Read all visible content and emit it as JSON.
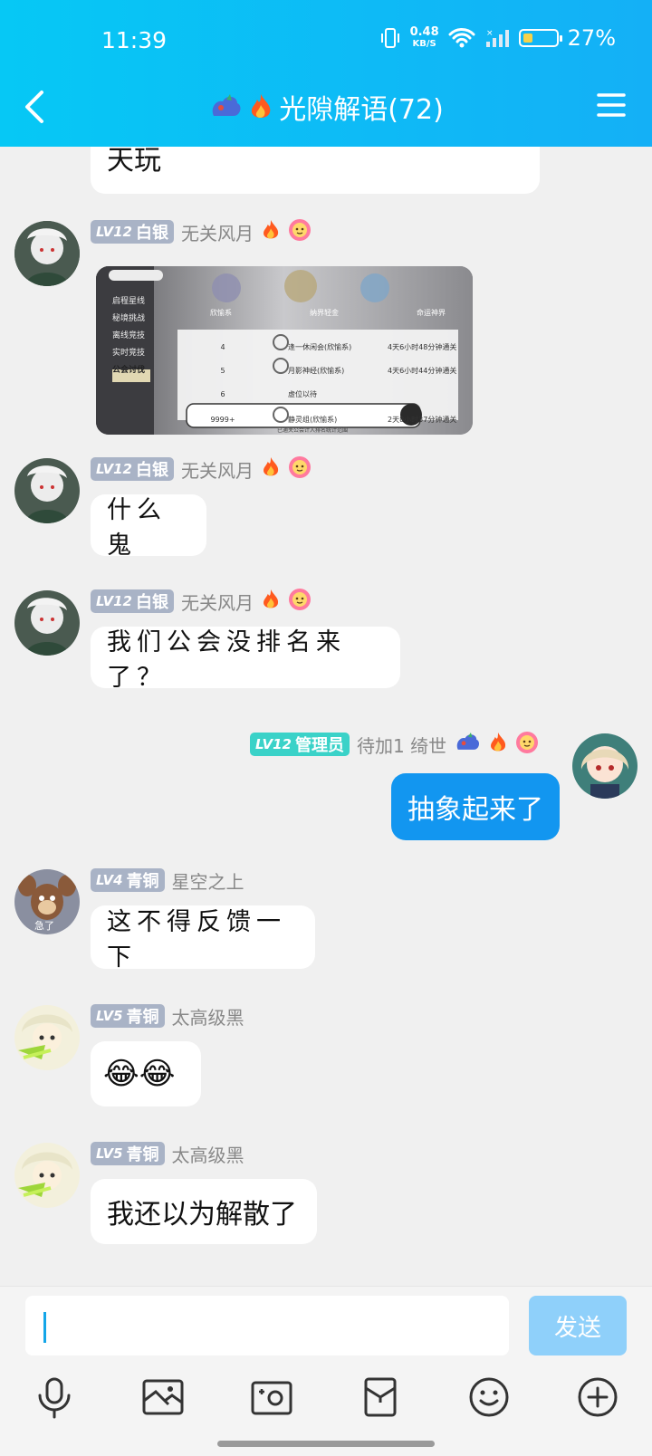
{
  "status_bar": {
    "time": "11:39",
    "net_speed_value": "0.48",
    "net_speed_unit": "KB/S",
    "battery_percent": "27%"
  },
  "header": {
    "title": "光隙解语(72)"
  },
  "messages": [
    {
      "text": "天玩"
    },
    {
      "level_tag": "LV12",
      "rank": "白银",
      "nickname": "无关风月",
      "content_type": "image"
    },
    {
      "level_tag": "LV12",
      "rank": "白银",
      "nickname": "无关风月",
      "text": "什么鬼"
    },
    {
      "level_tag": "LV12",
      "rank": "白银",
      "nickname": "无关风月",
      "text": "我们公会没排名来了？"
    },
    {
      "level_tag": "LV12",
      "rank": "管理员",
      "nickname": "待加1 绮世",
      "text": "抽象起来了",
      "mine": true
    },
    {
      "level_tag": "LV4",
      "rank": "青铜",
      "nickname": "星空之上",
      "text": "这不得反馈一下"
    },
    {
      "level_tag": "LV5",
      "rank": "青铜",
      "nickname": "太高级黑",
      "text": "😂😂"
    },
    {
      "level_tag": "LV5",
      "rank": "青铜",
      "nickname": "太高级黑",
      "text": "我还以为解散了"
    }
  ],
  "shared_image": {
    "menu": [
      "启程星线",
      "秘境挑战",
      "离线竞技",
      "实时竞技",
      "公会讨伐"
    ],
    "tiers": [
      "欣愉系",
      "纳界轻金",
      "命运神界"
    ],
    "rows": [
      {
        "rank": "4",
        "name": "逢一休闲会(欣愉系)",
        "lv": "Lv.6",
        "time": "4天6小时48分钟通关"
      },
      {
        "rank": "5",
        "name": "月影神经(欣愉系)",
        "lv": "Lv.6",
        "time": "4天6小时44分钟通关"
      },
      {
        "rank": "6",
        "name": "虚位以待",
        "lv": "",
        "time": ""
      },
      {
        "rank": "9999+",
        "name": "静灵组(欣愉系)",
        "lv": "Lv.6",
        "time": "2天8小时37分钟通关"
      }
    ],
    "footer": "已通关公会计入排名统计范围"
  },
  "composer": {
    "send_label": "发送",
    "input_value": ""
  },
  "colors": {
    "header_start": "#06c8f5",
    "header_end": "#14b0f6",
    "my_bubble": "#1296f0",
    "silver_tag": "#a9b3c6",
    "admin_tag": "#3ad2c8",
    "send_disabled": "#8fd0fa"
  },
  "icons": [
    "back-icon",
    "menu-icon",
    "group-emblem-icon",
    "fire-icon",
    "flower-badge-icon",
    "microphone-icon",
    "image-icon",
    "camera-icon",
    "red-packet-icon",
    "emoji-icon",
    "plus-icon"
  ]
}
